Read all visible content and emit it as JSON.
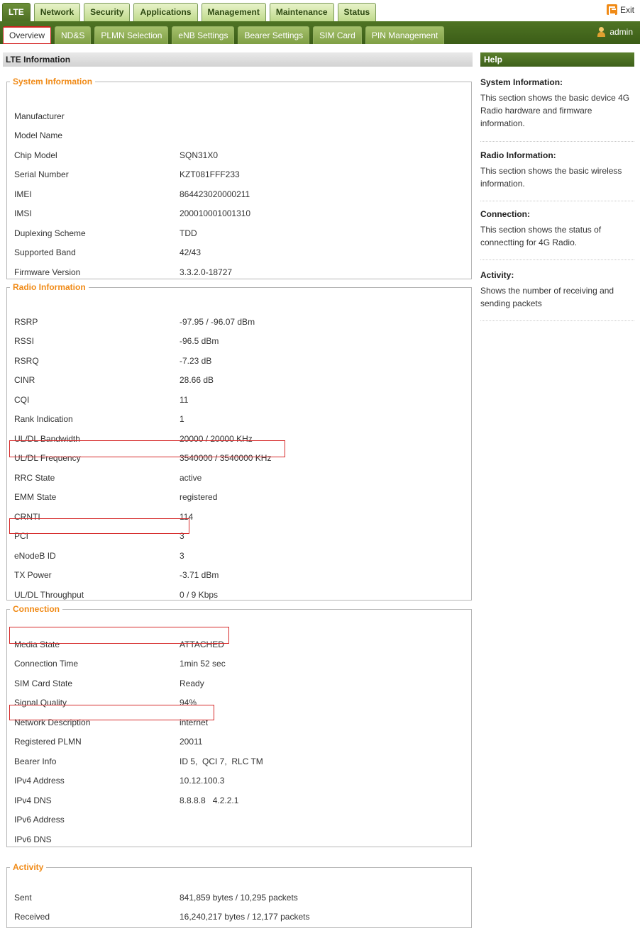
{
  "top_tabs": [
    "LTE",
    "Network",
    "Security",
    "Applications",
    "Management",
    "Maintenance",
    "Status"
  ],
  "exit_label": "Exit",
  "sub_tabs": [
    "Overview",
    "ND&S",
    "PLMN Selection",
    "eNB Settings",
    "Bearer Settings",
    "SIM Card",
    "PIN Management"
  ],
  "user_label": "admin",
  "main_title": "LTE Information",
  "system": {
    "title": "System Information",
    "rows": [
      {
        "label": "Manufacturer",
        "value": ""
      },
      {
        "label": "Model Name",
        "value": ""
      },
      {
        "label": "Chip Model",
        "value": "SQN31X0"
      },
      {
        "label": "Serial Number",
        "value": "KZT081FFF233"
      },
      {
        "label": "IMEI",
        "value": "864423020000211"
      },
      {
        "label": "IMSI",
        "value": "200010001001310"
      },
      {
        "label": "Duplexing Scheme",
        "value": "TDD"
      },
      {
        "label": "Supported Band",
        "value": "42/43"
      },
      {
        "label": "Firmware Version",
        "value": "3.3.2.0-18727"
      }
    ]
  },
  "radio": {
    "title": "Radio Information",
    "rows": [
      {
        "label": "RSRP",
        "value": "-97.95 / -96.07 dBm"
      },
      {
        "label": "RSSI",
        "value": "-96.5 dBm"
      },
      {
        "label": "RSRQ",
        "value": "-7.23 dB"
      },
      {
        "label": "CINR",
        "value": "28.66 dB"
      },
      {
        "label": "CQI",
        "value": "11"
      },
      {
        "label": "Rank Indication",
        "value": "1"
      },
      {
        "label": "UL/DL Bandwidth",
        "value": "20000 / 20000 KHz"
      },
      {
        "label": "UL/DL Frequency",
        "value": "3540000 / 3540000 KHz"
      },
      {
        "label": "RRC State",
        "value": "active"
      },
      {
        "label": "EMM State",
        "value": "registered"
      },
      {
        "label": "CRNTI",
        "value": "114"
      },
      {
        "label": "PCI",
        "value": "3"
      },
      {
        "label": "eNodeB ID",
        "value": "3"
      },
      {
        "label": "TX Power",
        "value": "-3.71 dBm"
      },
      {
        "label": "UL/DL Throughput",
        "value": "0 / 9 Kbps"
      }
    ]
  },
  "connection": {
    "title": "Connection",
    "rows": [
      {
        "label": "Media State",
        "value": "ATTACHED"
      },
      {
        "label": "Connection Time",
        "value": "1min 52 sec"
      },
      {
        "label": "SIM Card State",
        "value": "Ready"
      },
      {
        "label": "Signal Quality",
        "value": "94%"
      },
      {
        "label": "Network Description",
        "value": "internet"
      },
      {
        "label": "Registered PLMN",
        "value": "20011"
      },
      {
        "label": "Bearer Info",
        "value": "ID 5,  QCI 7,  RLC TM"
      },
      {
        "label": "IPv4 Address",
        "value": "10.12.100.3"
      },
      {
        "label": "IPv4 DNS",
        "value": "8.8.8.8   4.2.2.1"
      },
      {
        "label": "IPv6 Address",
        "value": ""
      },
      {
        "label": "IPv6 DNS",
        "value": ""
      }
    ]
  },
  "activity": {
    "title": "Activity",
    "rows": [
      {
        "label": "Sent",
        "value": "841,859 bytes / 10,295 packets"
      },
      {
        "label": "Received",
        "value": "16,240,217 bytes / 12,177 packets"
      }
    ]
  },
  "help": {
    "title": "Help",
    "items": [
      {
        "title": "System Information:",
        "desc": "This section shows the basic device 4G Radio hardware and firmware information."
      },
      {
        "title": "Radio Information:",
        "desc": "This section shows the basic wireless information."
      },
      {
        "title": "Connection:",
        "desc": "This section shows the status of connectting for 4G Radio."
      },
      {
        "title": "Activity:",
        "desc": "Shows the number of receiving and sending packets"
      }
    ]
  },
  "colors": {
    "brand_green": "#4f7424",
    "accent_orange": "#f08a16",
    "highlight_red": "#d62b2b"
  }
}
